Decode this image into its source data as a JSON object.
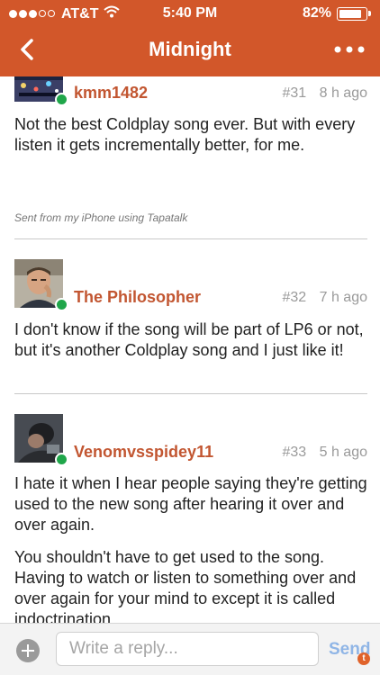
{
  "status_bar": {
    "carrier": "AT&T",
    "time": "5:40 PM",
    "battery": "82%",
    "battery_level": 0.82,
    "signal_dots": 5,
    "signal_filled": 3
  },
  "nav": {
    "title": "Midnight",
    "back_icon": "chevron-left-icon",
    "more_icon": "ellipsis-icon"
  },
  "colors": {
    "header": "#d2572a",
    "username": "#c25631",
    "online": "#1fa64a",
    "send": "#8fb5e6"
  },
  "posts": [
    {
      "username": "kmm1482",
      "number": "#31",
      "age": "8 h ago",
      "paragraphs": [
        "Not the best Coldplay song ever. But with every listen it gets incrementally better, for me."
      ],
      "signature": "Sent from my iPhone using Tapatalk",
      "online": true
    },
    {
      "username": "The Philosopher",
      "number": "#32",
      "age": "7 h ago",
      "paragraphs": [
        "I don't know if the song will be part of LP6 or not, but it's another Coldplay song and I just like it!"
      ],
      "online": true
    },
    {
      "username": "Venomvsspidey11",
      "number": "#33",
      "age": "5 h ago",
      "paragraphs": [
        "I hate it when I hear people saying they're getting used to the new song after hearing it over and over again.",
        "You shouldn't have to get used to the song. Having to watch or listen to something over and over again for your mind to except it is called indoctrination."
      ],
      "online": true
    }
  ],
  "reply": {
    "placeholder": "Write a reply...",
    "send_label": "Send",
    "badge": "t"
  }
}
